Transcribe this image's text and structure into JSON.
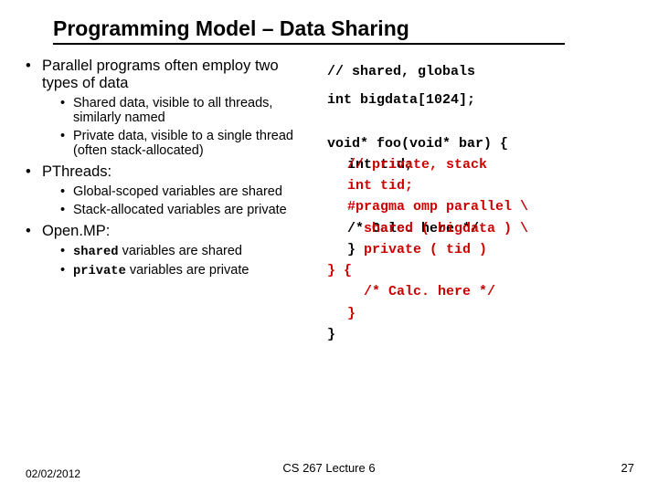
{
  "title": "Programming Model – Data Sharing",
  "bullets": {
    "intro": "Parallel programs often employ two types of data",
    "intro_sub1": "Shared data, visible to all threads, similarly named",
    "intro_sub2": "Private data, visible to a single thread (often stack-allocated)",
    "pthreads": "PThreads:",
    "pthreads_sub1": "Global-scoped variables are shared",
    "pthreads_sub2": "Stack-allocated variables are private",
    "openmp": "Open.MP:",
    "openmp_kw1": "shared",
    "openmp_txt1": " variables are shared",
    "openmp_kw2": "private",
    "openmp_txt2": " variables are private"
  },
  "code": {
    "l1": "// shared, globals",
    "l2": "int bigdata[1024];",
    "l3": "void* foo(void* bar) {",
    "l4a_black": "int tid;",
    "l4a_red_overlay": "// private, stack",
    "l5_black": "int tid;",
    "l6_black": "#pragma omp parallel \\",
    "l7_black_a": "/* Calc. here */",
    "l7_red_overlay_a": "shared ( bigdata ) \\",
    "l8_black": "}",
    "l8_red_overlay": "private ( tid )",
    "l9_red_a": "} ",
    "l9_red_b": "{",
    "l10_red": "/* Calc. here */",
    "l11_red": "}",
    "l12_black": "}"
  },
  "footer": {
    "date": "02/02/2012",
    "center": "CS 267 Lecture 6",
    "num": "27"
  }
}
